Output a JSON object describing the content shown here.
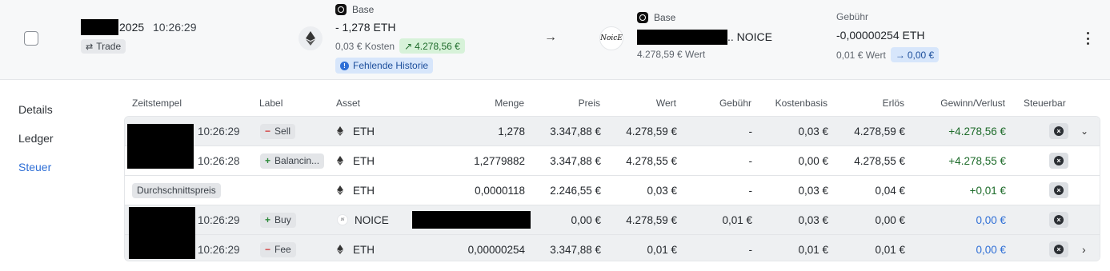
{
  "header": {
    "date_suffix": "2025",
    "time": "10:26:29",
    "type_tag": "Trade",
    "out": {
      "chain": "Base",
      "amount": "- 1,278 ETH",
      "cost": "0,03 € Kosten",
      "gain": "4.278,56 €",
      "warning": "Fehlende Historie"
    },
    "arrow": "→",
    "in": {
      "chain": "Base",
      "token_suffix": ".. NOICE",
      "value": "4.278,59 € Wert",
      "logo_text": "NoicE"
    },
    "fee": {
      "label": "Gebühr",
      "amount": "-0,00000254 ETH",
      "value": "0,01 € Wert",
      "delta": "0,00 €"
    }
  },
  "sidenav": [
    "Details",
    "Ledger",
    "Steuer"
  ],
  "sidenav_active": "Steuer",
  "columns": [
    "Zeitstempel",
    "Label",
    "Asset",
    "Menge",
    "Preis",
    "Wert",
    "Gebühr",
    "Kostenbasis",
    "Erlös",
    "Gewinn/Verlust",
    "Steuerbar"
  ],
  "rows": [
    {
      "time": "10:26:29",
      "label": "Sell",
      "sign": "minus",
      "asset": "ETH",
      "amount": "1,278",
      "price": "3.347,88 €",
      "value": "4.278,59 €",
      "fee": "-",
      "cost": "0,03 €",
      "proceeds": "4.278,59 €",
      "pnl": "+4.278,56 €"
    },
    {
      "time": "10:26:28",
      "label": "Balancin...",
      "sign": "plus",
      "asset": "ETH",
      "amount": "1,2779882",
      "price": "3.347,88 €",
      "value": "4.278,55 €",
      "fee": "-",
      "cost": "0,00 €",
      "proceeds": "4.278,55 €",
      "pnl": "+4.278,55 €"
    },
    {
      "label": "Durchschnittspreis",
      "asset": "ETH",
      "amount": "0,0000118",
      "price": "2.246,55 €",
      "value": "0,03 €",
      "fee": "-",
      "cost": "0,03 €",
      "proceeds": "0,04 €",
      "pnl": "+0,01 €"
    },
    {
      "time": "10:26:29",
      "label": "Buy",
      "sign": "plus",
      "asset": "NOICE",
      "price": "0,00 €",
      "value": "4.278,59 €",
      "fee": "0,01 €",
      "cost": "0,03 €",
      "proceeds": "0,00 €",
      "pnl": "0,00 €"
    },
    {
      "time": "10:26:29",
      "label": "Fee",
      "sign": "minus",
      "asset": "ETH",
      "amount": "0,00000254",
      "price": "3.347,88 €",
      "value": "0,01 €",
      "fee": "-",
      "cost": "0,01 €",
      "proceeds": "0,01 €",
      "pnl": "0,00 €"
    }
  ],
  "colors": {
    "positive": "#1d6b2a",
    "link_blue": "#2f6fd6",
    "gain_pill": "#d7f2d9",
    "info_pill": "#d7e6fb"
  }
}
